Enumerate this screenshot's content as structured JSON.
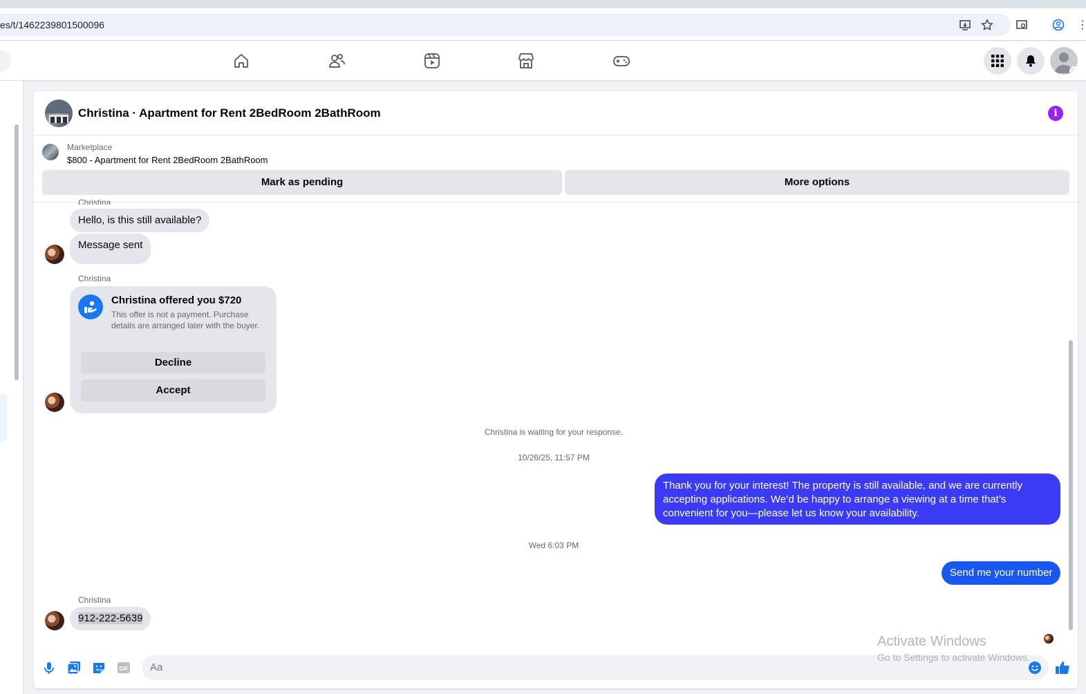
{
  "browser": {
    "url": "es/t/1462239801500096"
  },
  "chat": {
    "header_title": "Christina · Apartment for Rent 2BedRoom 2BathRoom",
    "marketplace_label": "Marketplace",
    "listing": "$800 - Apartment for Rent 2BedRoom 2BathRoom",
    "mark_pending_label": "Mark as pending",
    "more_options_label": "More options"
  },
  "messages": {
    "sender_top": "Christina",
    "in_1": "Hello, is this still available?",
    "in_2": "Message sent",
    "offer_sender": "Christina",
    "offer_title": "Christina offered you $720",
    "offer_desc": "This offer is not a payment. Purchase details are arranged later with the buyer.",
    "decline_label": "Decline",
    "accept_label": "Accept",
    "waiting_note": "Christina is waiting for your response.",
    "timestamp_1": "10/26/25, 11:57 PM",
    "out_1": "Thank you for your interest! The property is still available, and we are currently accepting applications. We’d be happy to arrange a viewing at a time that’s convenient for you—please let us know your availability.",
    "timestamp_2": "Wed 6:03 PM",
    "out_2": "Send me your number",
    "last_sender": "Christina",
    "in_3": "912-222-5639"
  },
  "composer": {
    "placeholder": "Aa"
  },
  "watermark": {
    "line1": "Activate Windows",
    "line2": "Go to Settings to activate Windows."
  },
  "colors": {
    "accent": "#1877f2",
    "outgoing_bubble": "#0a7cff",
    "incoming_bubble": "#e4e6eb",
    "info_icon": "#a020f0"
  },
  "icons": [
    "home-icon",
    "friends-icon",
    "watch-icon",
    "marketplace-icon",
    "gaming-icon",
    "menu-grid-icon",
    "bell-icon",
    "mic-icon",
    "photo-icon",
    "sticker-icon",
    "gif-icon",
    "emoji-icon",
    "like-icon",
    "info-icon",
    "offer-hand-icon"
  ]
}
